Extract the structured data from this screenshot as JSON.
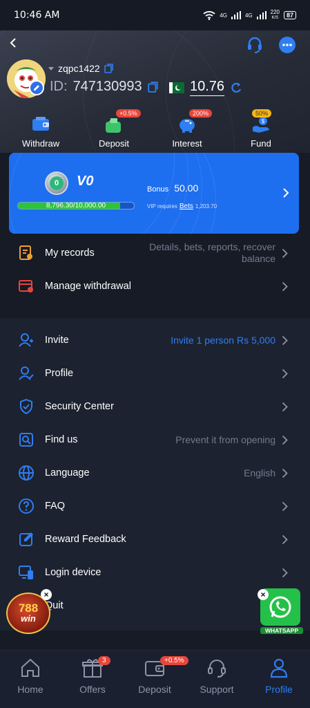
{
  "status_bar": {
    "time": "10:46 AM",
    "network": "4G",
    "network2": "4G",
    "speed": "220",
    "speed_unit": "K/S",
    "battery": "87"
  },
  "profile": {
    "username": "zqpc1422",
    "id_label": "ID:",
    "id_value": "747130993",
    "balance": "10.76"
  },
  "quick_actions": [
    {
      "label": "Withdraw",
      "icon": "wallet-icon"
    },
    {
      "label": "Deposit",
      "icon": "money-bag-icon",
      "badge": "+0.5%"
    },
    {
      "label": "Interest",
      "icon": "piggy-bank-icon",
      "badge": "200%"
    },
    {
      "label": "Fund",
      "icon": "hand-coin-icon",
      "badge": "50%"
    }
  ],
  "vip": {
    "level": "V0",
    "medal_number": "0",
    "progress_text": "8,796.30/10,000.00",
    "progress_fraction": 0.88,
    "bonus_label": "Bonus",
    "bonus_value": "50.00",
    "requires_label": "VIP requires",
    "bets_label": "Bets",
    "bets_value": "1,203.70"
  },
  "records_menu": [
    {
      "label": "My records",
      "value": "Details, bets, reports, recover balance"
    },
    {
      "label": "Manage withdrawal",
      "value": ""
    }
  ],
  "main_menu": [
    {
      "label": "Invite",
      "value": "Invite 1 person Rs 5,000"
    },
    {
      "label": "Profile",
      "value": ""
    },
    {
      "label": "Security Center",
      "value": ""
    },
    {
      "label": "Find us",
      "value": "Prevent it from opening"
    },
    {
      "label": "Language",
      "value": "English"
    },
    {
      "label": "FAQ",
      "value": ""
    },
    {
      "label": "Reward Feedback",
      "value": ""
    },
    {
      "label": "Login device",
      "value": ""
    },
    {
      "label": "Quit",
      "value": ""
    }
  ],
  "floating": {
    "promo_line1": "788",
    "promo_line2": "win",
    "whatsapp_label": "WHATSAPP"
  },
  "bottom_nav": [
    {
      "label": "Home",
      "icon": "home-icon"
    },
    {
      "label": "Offers",
      "icon": "gift-icon",
      "badge": "3"
    },
    {
      "label": "Deposit",
      "icon": "wallet-icon",
      "badge": "+0.5%"
    },
    {
      "label": "Support",
      "icon": "headset-icon"
    },
    {
      "label": "Profile",
      "icon": "person-icon",
      "active": true
    }
  ],
  "colors": {
    "accent": "#2f7ef2",
    "vip_card": "#1e6ef0",
    "progress": "#2ec436",
    "badge": "#e7463a",
    "gold_badge": "#f5b51c"
  }
}
